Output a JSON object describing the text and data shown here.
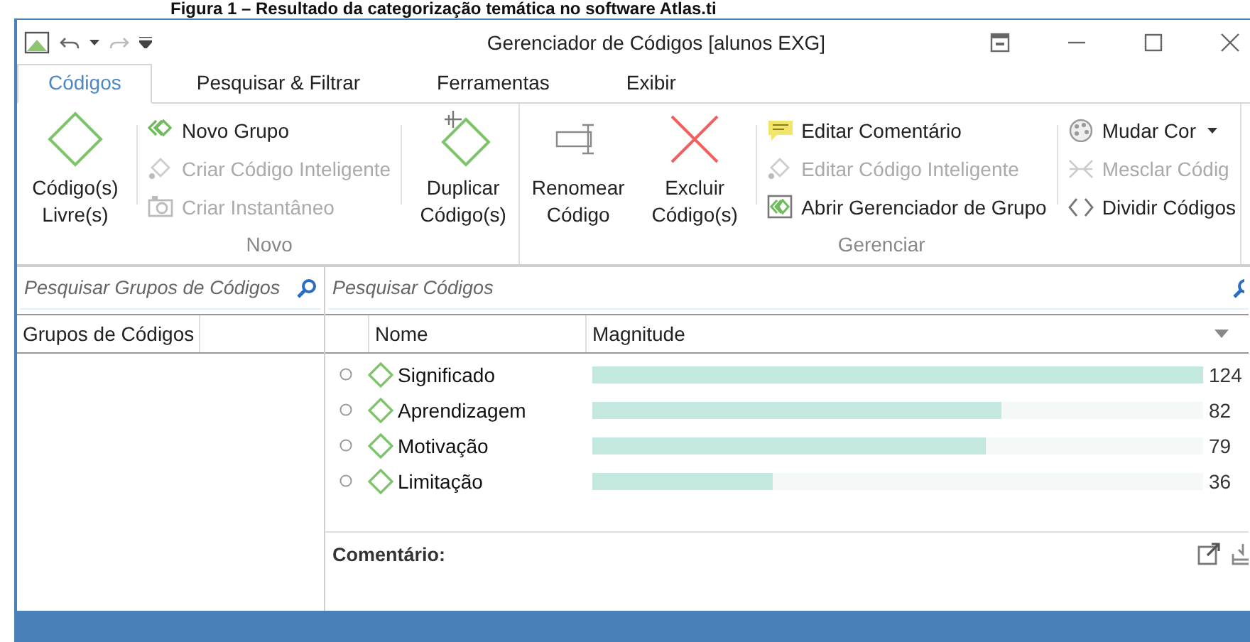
{
  "caption": "Figura 1 – Resultado da categorização temática no software Atlas.ti",
  "window": {
    "title": "Gerenciador de Códigos [alunos EXG]"
  },
  "tabs": [
    {
      "label": "Códigos",
      "selected": true
    },
    {
      "label": "Pesquisar & Filtrar",
      "selected": false
    },
    {
      "label": "Ferramentas",
      "selected": false
    },
    {
      "label": "Exibir",
      "selected": false
    }
  ],
  "ribbon": {
    "groups": [
      {
        "label": "Novo",
        "columns": [
          {
            "kind": "large",
            "label": "Código(s) Livre(s)",
            "disabled": false
          },
          {
            "kind": "stack",
            "items": [
              {
                "label": "Novo Grupo",
                "disabled": false
              },
              {
                "label": "Criar Código Inteligente",
                "disabled": true
              },
              {
                "label": "Criar Instantâneo",
                "disabled": true
              }
            ]
          },
          {
            "kind": "large",
            "label": "Duplicar Código(s)",
            "disabled": false
          }
        ]
      },
      {
        "label": "Gerenciar",
        "columns": [
          {
            "kind": "large",
            "label": "Renomear Código",
            "disabled": false
          },
          {
            "kind": "large",
            "label": "Excluir Código(s)",
            "disabled": false
          },
          {
            "kind": "stack",
            "items": [
              {
                "label": "Editar Comentário",
                "disabled": false
              },
              {
                "label": "Editar Código Inteligente",
                "disabled": true
              },
              {
                "label": "Abrir Gerenciador de Grupo",
                "disabled": false
              }
            ]
          },
          {
            "kind": "stack",
            "items": [
              {
                "label": "Mudar Cor",
                "disabled": false,
                "dropdown": true
              },
              {
                "label": "Mesclar Códig",
                "disabled": true
              },
              {
                "label": "Dividir Códigos",
                "disabled": false
              }
            ]
          }
        ]
      }
    ]
  },
  "groups_pane": {
    "search": {
      "placeholder": "Pesquisar Grupos de Códigos"
    },
    "column": "Grupos de Códigos"
  },
  "codes_pane": {
    "search": {
      "placeholder": "Pesquisar Códigos"
    },
    "columns": [
      "Nome",
      "Magnitude"
    ],
    "rows": [
      {
        "name": "Significado",
        "level": 1,
        "value": "124"
      },
      {
        "name": "Aprendizagem",
        "level": 0.67,
        "value": "82"
      },
      {
        "name": "Motivação",
        "level": 0.645,
        "value": "79"
      },
      {
        "name": "Limitação",
        "level": 0.295,
        "value": "36"
      }
    ]
  },
  "comment": {
    "label": "Comentário:"
  }
}
